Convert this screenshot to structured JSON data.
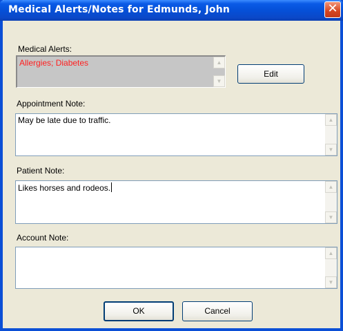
{
  "window": {
    "title": "Medical Alerts/Notes for Edmunds, John"
  },
  "medical_alerts": {
    "label": "Medical Alerts:",
    "value": "Allergies; Diabetes",
    "edit_label": "Edit"
  },
  "appointment_note": {
    "label": "Appointment Note:",
    "value": "May be late due to traffic."
  },
  "patient_note": {
    "label": "Patient Note:",
    "value": "Likes horses and rodeos."
  },
  "account_note": {
    "label": "Account Note:",
    "value": ""
  },
  "buttons": {
    "ok": "OK",
    "cancel": "Cancel"
  },
  "icons": {
    "close": "close-icon",
    "scroll_up": "arrow-up-icon",
    "scroll_down": "arrow-down-icon"
  },
  "colors": {
    "titlebar": "#0550d8",
    "alert_text": "#ff2020",
    "dialog_bg": "#ece9d8"
  }
}
